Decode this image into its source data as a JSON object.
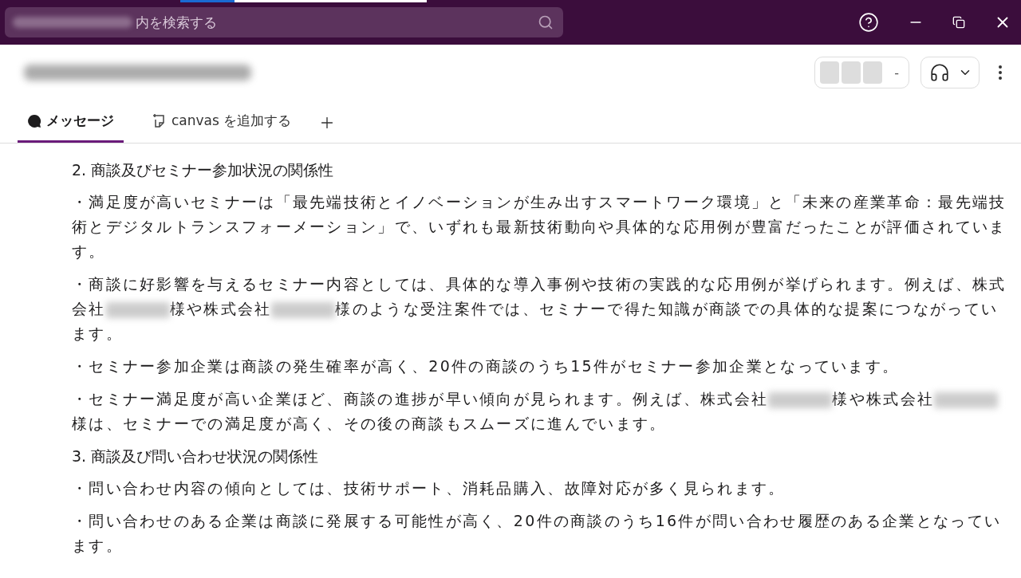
{
  "search": {
    "placeholder": "内を検索する"
  },
  "member_count": "-",
  "tabs": [
    {
      "label": "メッセージ",
      "kind": "messages",
      "selected": true
    },
    {
      "label": "canvas を追加する",
      "kind": "canvas",
      "selected": false
    }
  ],
  "heading_1": "2. 商談及びセミナー参加状況の関係性",
  "paragraphs_1": [
    {
      "segments": [
        {
          "kind": "text",
          "text": "・満足度が高いセミナーは「最先端技術とイノベーションが生み出すスマートワーク環境」と「未来の産業革命：最先端技術とデジタルトランスフォーメーション」で、いずれも最新技術動向や具体的な応用例が豊富だったことが評価されています。"
        }
      ]
    },
    {
      "segments": [
        {
          "kind": "text",
          "text": "・商談に好影響を与えるセミナー内容としては、具体的な導入事例や技術の実践的な応用例が挙げられます。例えば、株式会社"
        },
        {
          "kind": "redacted"
        },
        {
          "kind": "text",
          "text": "様や株式会社"
        },
        {
          "kind": "redacted"
        },
        {
          "kind": "text",
          "text": "様のような受注案件では、セミナーで得た知識が商談での具体的な提案につながっています。"
        }
      ]
    },
    {
      "segments": [
        {
          "kind": "text",
          "text": "・セミナー参加企業は商談の発生確率が高く、20件の商談のうち15件がセミナー参加企業となっています。"
        }
      ]
    },
    {
      "segments": [
        {
          "kind": "text",
          "text": "・セミナー満足度が高い企業ほど、商談の進捗が早い傾向が見られます。例えば、株式会社"
        },
        {
          "kind": "redacted"
        },
        {
          "kind": "text",
          "text": "様や株式会社"
        },
        {
          "kind": "redacted"
        },
        {
          "kind": "text",
          "text": "様は、セミナーでの満足度が高く、その後の商談もスムーズに進んでいます。"
        }
      ]
    }
  ],
  "heading_2": "3. 商談及び問い合わせ状況の関係性",
  "paragraphs_2": [
    {
      "segments": [
        {
          "kind": "text",
          "text": "・問い合わせ内容の傾向としては、技術サポート、消耗品購入、故障対応が多く見られます。"
        }
      ]
    },
    {
      "segments": [
        {
          "kind": "text",
          "text": "・問い合わせのある企業は商談に発展する可能性が高く、20件の商談のうち16件が問い合わせ履歴のある企業となっています。"
        }
      ]
    }
  ]
}
